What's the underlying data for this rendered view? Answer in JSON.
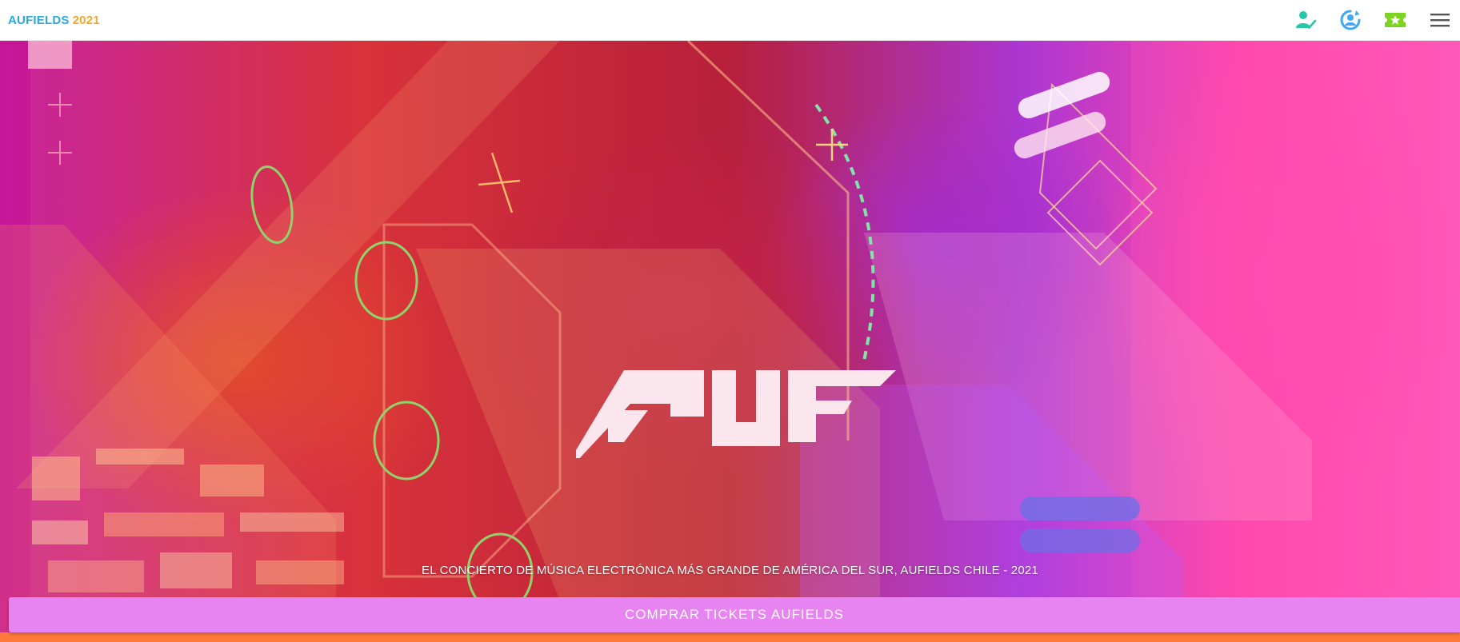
{
  "header": {
    "brand_name": "AUFIELDS",
    "brand_year": "2021",
    "icons": [
      "user-check-icon",
      "refresh-user-icon",
      "ticket-star-icon",
      "hamburger-menu-icon"
    ]
  },
  "hero": {
    "logo_text": "AUF",
    "tagline": "EL CONCIERTO DE MÚSICA ELECTRÓNICA MÁS GRANDE DE AMÉRICA DEL SUR, AUFIELDS CHILE - 2021",
    "cta_label": "COMPRAR TICKETS AUFIELDS"
  },
  "colors": {
    "brand_blue": "#29a8e0",
    "brand_orange": "#f6a623",
    "icon_teal": "#26c6a6",
    "icon_blue": "#3fa9f5",
    "icon_green": "#7ed321",
    "cta_bg": "#e884f2"
  }
}
